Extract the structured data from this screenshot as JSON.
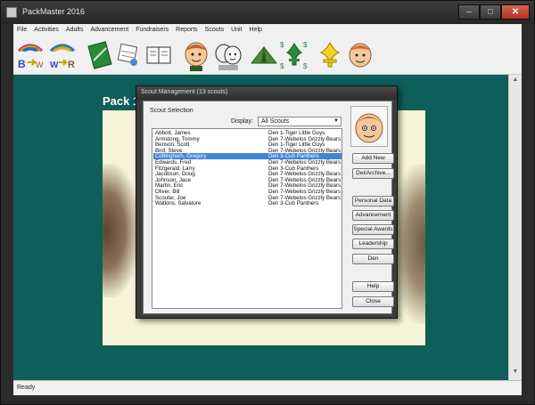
{
  "window": {
    "title": "PackMaster 2016"
  },
  "menubar": {
    "items": [
      "File",
      "Activities",
      "Adults",
      "Advancement",
      "Fundraisers",
      "Reports",
      "Scouts",
      "Unit",
      "Help"
    ]
  },
  "toolbar": {
    "icons": [
      "bobcat-rank-icon",
      "rank-advance-icon",
      "notebook-icon",
      "calendar-icon",
      "ledger-icon",
      "scout-face-icon",
      "parents-icon",
      "tent-icon",
      "money-fleur-icon",
      "fleur-de-lis-icon",
      "cub-face-icon"
    ]
  },
  "workspace": {
    "pack_title": "Pack 12",
    "bg_color": "#0e5e5a"
  },
  "status": {
    "text": "Ready"
  },
  "dialog": {
    "title": "Scout Management  (13 scouts)",
    "section_label": "Scout Selection",
    "display_label": "Display:",
    "display_value": "All Scouts",
    "selected_color": "#3f86d8",
    "scouts": [
      {
        "name": "Abbott,  James",
        "den": "Den 1-Tiger Little Guys"
      },
      {
        "name": "Armstong,  Tommy",
        "den": "Den 7-Webelos Grizzly Bears"
      },
      {
        "name": "Benson,  Scott",
        "den": "Den 1-Tiger Little Guys"
      },
      {
        "name": "Bird,  Steve",
        "den": "Den 7-Webelos Grizzly Bears"
      },
      {
        "name": "Cottingham,  Gregory",
        "den": "Den 3-Cub Panthers",
        "selected": true
      },
      {
        "name": "Edwards,  Fred",
        "den": "Den 7-Webelos Grizzly Bears"
      },
      {
        "name": "Fitzgerald,  Larry",
        "den": "Den 3-Cub Panthers"
      },
      {
        "name": "Jacobson,  Doug",
        "den": "Den 7-Webelos Grizzly Bears"
      },
      {
        "name": "Johnson,  Jace",
        "den": "Den 7-Webelos Grizzly Bears"
      },
      {
        "name": "Martin,  Eric",
        "den": "Den 7-Webelos Grizzly Bears"
      },
      {
        "name": "Oliver,  Bill",
        "den": "Den 7-Webelos Grizzly Bears"
      },
      {
        "name": "Scouter,  Joe",
        "den": "Den 7-Webelos Grizzly Bears"
      },
      {
        "name": "Watkins,  Salvatore",
        "den": "Den 3-Cub Panthers"
      }
    ],
    "buttons": {
      "add_new": "Add New",
      "del_archive": "Del/Archive...",
      "personal_data": "Personal Data",
      "advancement": "Advancement",
      "special_awards": "Special Awards",
      "leadership": "Leadership",
      "den": "Den",
      "help": "Help",
      "close": "Close"
    }
  }
}
